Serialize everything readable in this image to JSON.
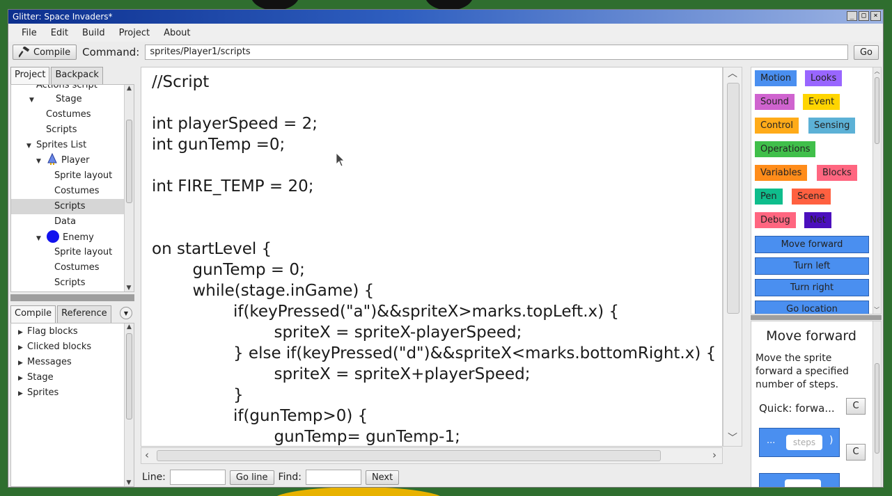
{
  "window": {
    "title": "Glitter: Space Invaders*"
  },
  "titlebar_buttons": {
    "minimize": "_",
    "maximize": "□",
    "close": "×"
  },
  "menu": [
    "File",
    "Edit",
    "Build",
    "Project",
    "About"
  ],
  "toolbar": {
    "compile_label": "Compile",
    "command_label": "Command:",
    "command_value": "sprites/Player1/scripts",
    "go_label": "Go"
  },
  "project_tabs": [
    "Project",
    "Backpack"
  ],
  "project_tree": [
    {
      "label": "Actions script",
      "indent": 36,
      "arrow": ""
    },
    {
      "label": "Stage",
      "indent": 26,
      "arrow": "▼",
      "pad": 64
    },
    {
      "label": "Costumes",
      "indent": 50,
      "arrow": ""
    },
    {
      "label": "Scripts",
      "indent": 50,
      "arrow": ""
    },
    {
      "label": "Sprites List",
      "indent": 22,
      "arrow": "▼"
    },
    {
      "label": "Player",
      "indent": 36,
      "arrow": "▼",
      "icon": "player"
    },
    {
      "label": "Sprite layout",
      "indent": 62,
      "arrow": ""
    },
    {
      "label": "Costumes",
      "indent": 62,
      "arrow": ""
    },
    {
      "label": "Scripts",
      "indent": 62,
      "arrow": "",
      "selected": true
    },
    {
      "label": "Data",
      "indent": 62,
      "arrow": ""
    },
    {
      "label": "Enemy",
      "indent": 36,
      "arrow": "▼",
      "icon": "enemy"
    },
    {
      "label": "Sprite layout",
      "indent": 62,
      "arrow": ""
    },
    {
      "label": "Costumes",
      "indent": 62,
      "arrow": ""
    },
    {
      "label": "Scripts",
      "indent": 62,
      "arrow": ""
    }
  ],
  "reference_tabs": [
    "Compile",
    "Reference"
  ],
  "reference_tree": [
    "Flag blocks",
    "Clicked blocks",
    "Messages",
    "Stage",
    "Sprites"
  ],
  "code_lines": [
    "//Script",
    "",
    "int playerSpeed = 2;",
    "int gunTemp =0;",
    "",
    "int FIRE_TEMP = 20;",
    "",
    "",
    "on startLevel {",
    "        gunTemp = 0;",
    "        while(stage.inGame) {",
    "                if(keyPressed(\"a\")&&spriteX>marks.topLeft.x) {",
    "                        spriteX = spriteX-playerSpeed;",
    "                } else if(keyPressed(\"d\")&&spriteX<marks.bottomRight.x) {",
    "                        spriteX = spriteX+playerSpeed;",
    "                }",
    "                if(gunTemp>0) {",
    "                        gunTemp= gunTemp-1;"
  ],
  "findbar": {
    "line_label": "Line:",
    "go_line_label": "Go line",
    "find_label": "Find:",
    "next_label": "Next"
  },
  "categories": [
    {
      "label": "Motion",
      "color": "#4a8ff0"
    },
    {
      "label": "Looks",
      "color": "#9966ff"
    },
    {
      "label": "Sound",
      "color": "#cf63cf"
    },
    {
      "label": "Event",
      "color": "#ffd500"
    },
    {
      "label": "Control",
      "color": "#ffab19"
    },
    {
      "label": "Sensing",
      "color": "#5cb1d6"
    },
    {
      "label": "Operations",
      "color": "#40bf4a"
    },
    {
      "label": "Variables",
      "color": "#ff8c1a"
    },
    {
      "label": "Blocks",
      "color": "#ff6680"
    },
    {
      "label": "Pen",
      "color": "#0fbd8c"
    },
    {
      "label": "Scene",
      "color": "#ff6040"
    },
    {
      "label": "Debug",
      "color": "#ff6680"
    },
    {
      "label": "Net",
      "color": "#4b0fbd"
    }
  ],
  "blocks": [
    "Move forward",
    "Turn left",
    "Turn right",
    "Go location"
  ],
  "help": {
    "title": "Move forward",
    "description": "Move the sprite forward a specified number of steps.",
    "quick_label": "Quick: forwa...",
    "c_label": "C",
    "block_prefix": "...",
    "steps_placeholder": "steps",
    "block_suffix": ")"
  }
}
